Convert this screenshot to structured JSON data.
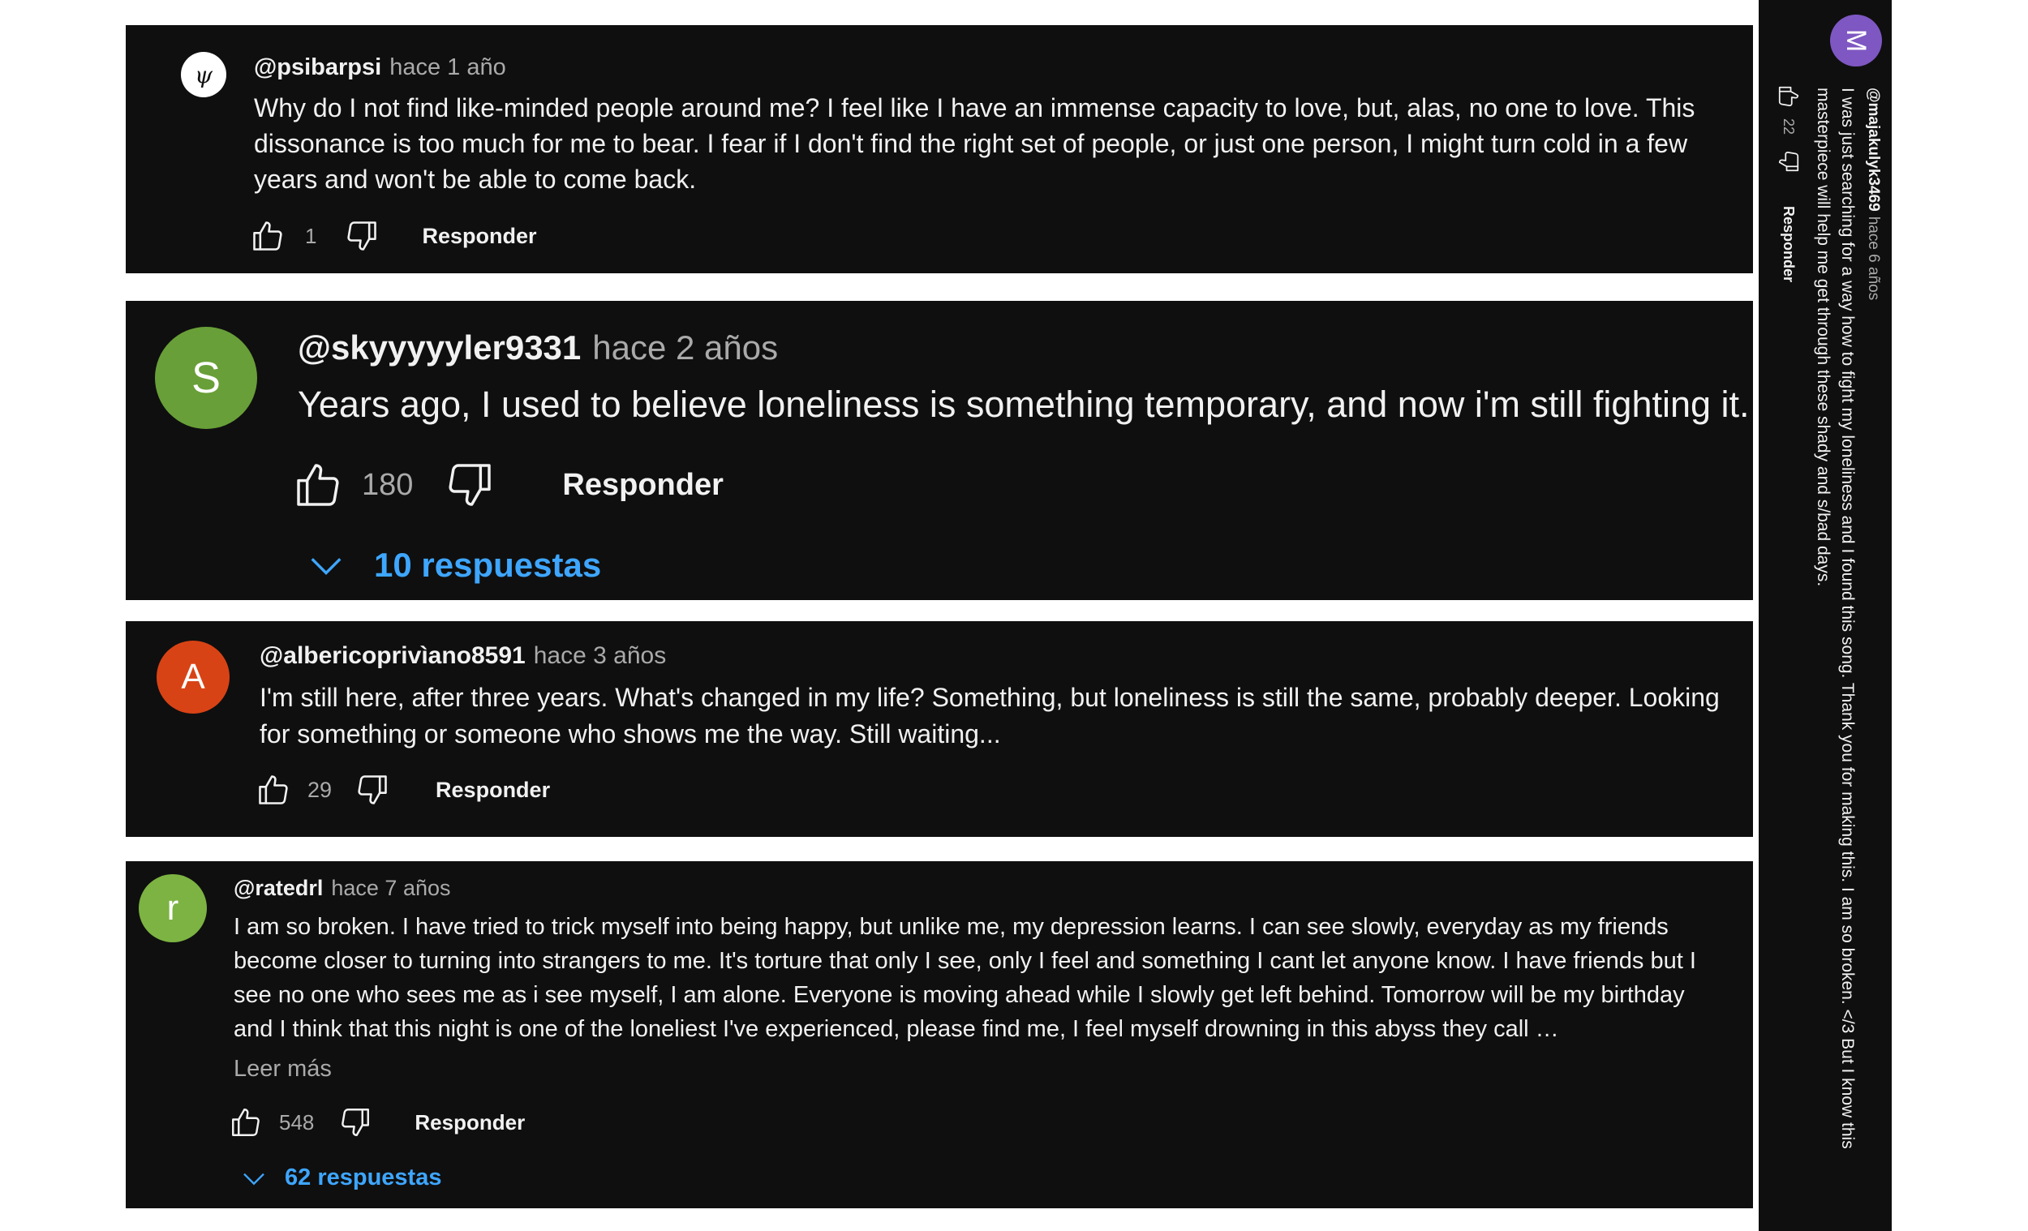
{
  "comments": [
    {
      "avatar_letter": "ψ",
      "avatar_color": "#ffffff",
      "handle": "@psibarpsi",
      "time": "hace 1 año",
      "text": "Why do I not find like-minded people around me? I feel like I have an immense capacity to love, but, alas, no one to love. This dissonance is too much for me to bear. I fear if I don't find the right set of people, or just one person, I might turn cold in a few years and won't be able to come back.",
      "likes": "1",
      "reply_label": "Responder"
    },
    {
      "avatar_letter": "S",
      "avatar_color": "#689f38",
      "handle": "@skyyyyyler9331",
      "time": "hace 2 años",
      "text": "Years ago, I used to believe loneliness is something temporary, and now i'm still fighting it.",
      "likes": "180",
      "reply_label": "Responder",
      "replies_label": "10 respuestas"
    },
    {
      "avatar_letter": "A",
      "avatar_color": "#d84315",
      "handle": "@albericoprivìano8591",
      "time": "hace 3 años",
      "text": "I'm still here, after three years. What's changed in my life? Something, but loneliness is still the same, probably deeper. Looking for something or someone who shows me the way. Still waiting...",
      "likes": "29",
      "reply_label": "Responder"
    },
    {
      "avatar_letter": "r",
      "avatar_color": "#7cb342",
      "handle": "@ratedrl",
      "time": "hace 7 años",
      "text": "I am so broken. I have tried to trick myself into being happy, but unlike me, my depression learns. I can see slowly, everyday as my friends become closer to turning into strangers to me. It's torture that only I see, only I feel and something I cant let anyone know. I have friends but I see no one who sees me as i see myself, I am alone. Everyone is moving ahead while I slowly get left behind. Tomorrow will be my birthday and I think that this night is one of the loneliest I've experienced, please find me, I feel myself drowning in this abyss they call …",
      "read_more": "Leer más",
      "likes": "548",
      "reply_label": "Responder",
      "replies_label": "62 respuestas"
    }
  ],
  "sidebar": {
    "avatar_letter": "M",
    "avatar_color": "#7e57c2",
    "handle": "@majakulyk3469",
    "time": "hace 6 años",
    "text": "I was just searching for a way how to fight my loneliness and I found this song. Thank you for making this. I am so broken. </3 But I know this masterpiece will help me get through these shady and s/bad days.",
    "likes": "22",
    "reply_label": "Responder"
  }
}
